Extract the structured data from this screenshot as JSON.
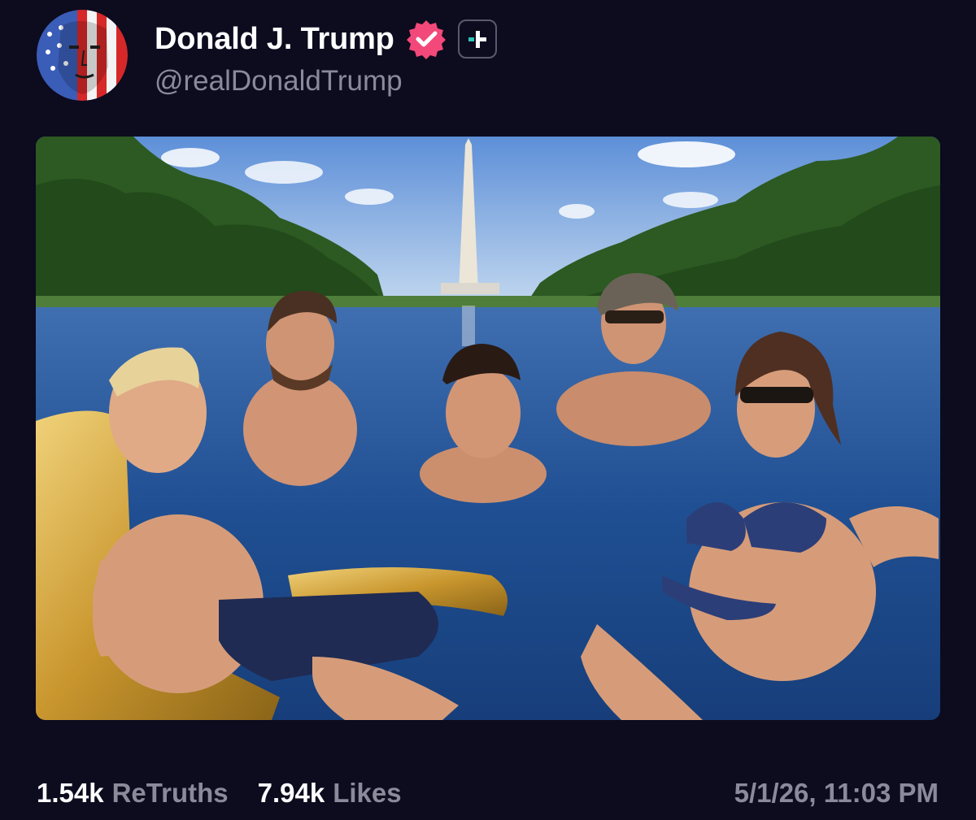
{
  "post": {
    "author": {
      "display_name": "Donald J. Trump",
      "handle": "@realDonaldTrump",
      "verified": true,
      "avatar_icon": "flag-face-avatar",
      "verified_icon": "verified-badge-icon",
      "verified_color": "#f2487a",
      "subscribe_icon": "plus-icon",
      "subscribe_accent": "#2ec4b6"
    },
    "media": {
      "icon": "photo-image"
    },
    "stats": {
      "retruths_count": "1.54k",
      "retruths_label": "ReTruths",
      "likes_count": "7.94k",
      "likes_label": "Likes"
    },
    "timestamp": "5/1/26, 11:03 PM"
  },
  "theme": {
    "background": "#0d0b1e",
    "text_primary": "#ffffff",
    "text_secondary": "#8a8a9a"
  }
}
